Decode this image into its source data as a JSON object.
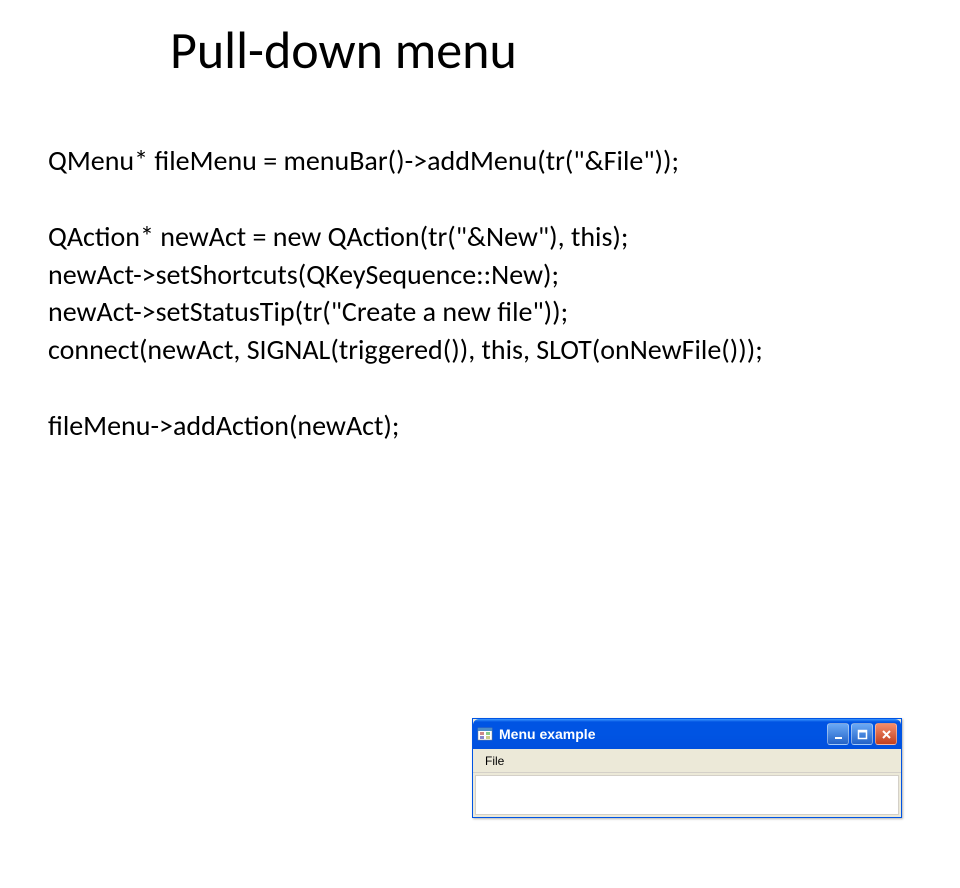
{
  "title": "Pull-down menu",
  "code": {
    "line1": "QMenu* fileMenu = menuBar()->addMenu(tr(\"&File\"));",
    "line2": "QAction* newAct = new QAction(tr(\"&New\"), this);",
    "line3": "newAct->setShortcuts(QKeySequence::New);",
    "line4": "newAct->setStatusTip(tr(\"Create a new file\"));",
    "line5": "connect(newAct, SIGNAL(triggered()), this, SLOT(onNewFile()));",
    "line6": "fileMenu->addAction(newAct);"
  },
  "window": {
    "title": "Menu example",
    "menu": {
      "file": "File"
    }
  }
}
